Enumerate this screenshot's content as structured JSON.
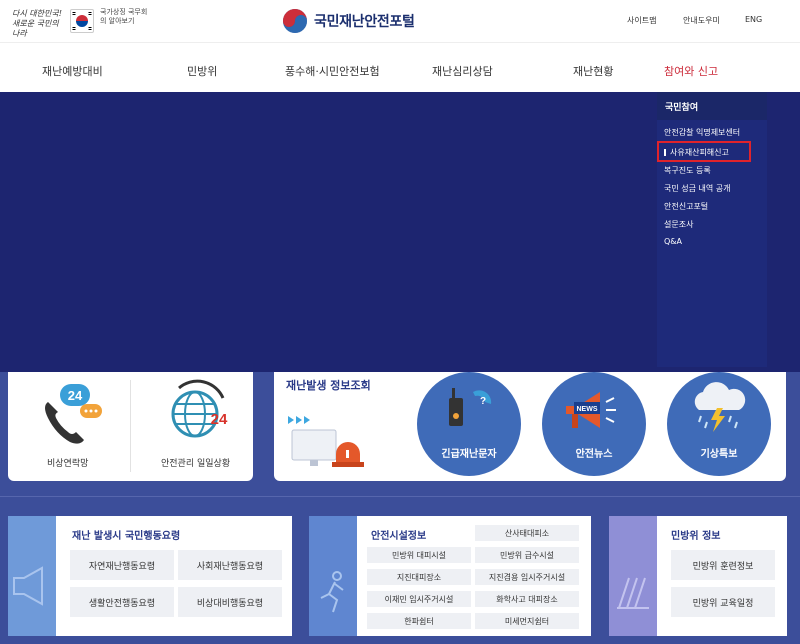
{
  "header": {
    "slogan_line1": "다시 대한민국!",
    "slogan_line2": "새로운 국민의 나라",
    "gov_text": "국가상징 국무회의 알아보기",
    "logo_title": "국민재난안전포털",
    "util_links": [
      "사이트맵",
      "안내도우미",
      "ENG"
    ]
  },
  "nav": {
    "items": [
      "재난예방대비",
      "민방위",
      "풍수해·시민안전보험",
      "재난심리상담",
      "재난현황",
      "참여와 신고"
    ],
    "active_index": 5
  },
  "submenu": {
    "heading": "국민참여",
    "items": [
      "안전감찰 익명제보센터",
      "사유재산피해신고",
      "복구진도 등록",
      "국민 성금 내역 공개",
      "안전신고포털",
      "설문조사",
      "Q&A"
    ],
    "highlighted_index": 1
  },
  "quick": {
    "emergency_label": "비상연락망",
    "safety_label": "안전관리 일일상황",
    "badge_24": "24"
  },
  "disaster_info": {
    "title": "재난발생 정보조회",
    "circles": [
      "긴급재난문자",
      "안전뉴스",
      "기상특보"
    ],
    "news_badge": "NEWS"
  },
  "action_guide": {
    "title": "재난 발생시 국민행동요령",
    "buttons": [
      "자연재난행동요령",
      "사회재난행동요령",
      "생활안전행동요령",
      "비상대비행동요령"
    ]
  },
  "facilities": {
    "title": "안전시설정보",
    "buttons": [
      "산사태대피소",
      "민방위 대피시설",
      "민방위 급수시설",
      "지진대피장소",
      "지진겸용 임시주거시설",
      "이재민 임시주거시설",
      "화학사고 대피장소",
      "한파쉼터",
      "미세먼지쉼터"
    ]
  },
  "civil_defense": {
    "title": "민방위 정보",
    "buttons": [
      "민방위 훈련정보",
      "민방위 교육일정"
    ]
  },
  "colors": {
    "hero_bg": "#1d2570",
    "active_nav": "#cc2b3a",
    "highlight_border": "#e0232b",
    "circle_blue": "#3f6bb8"
  }
}
